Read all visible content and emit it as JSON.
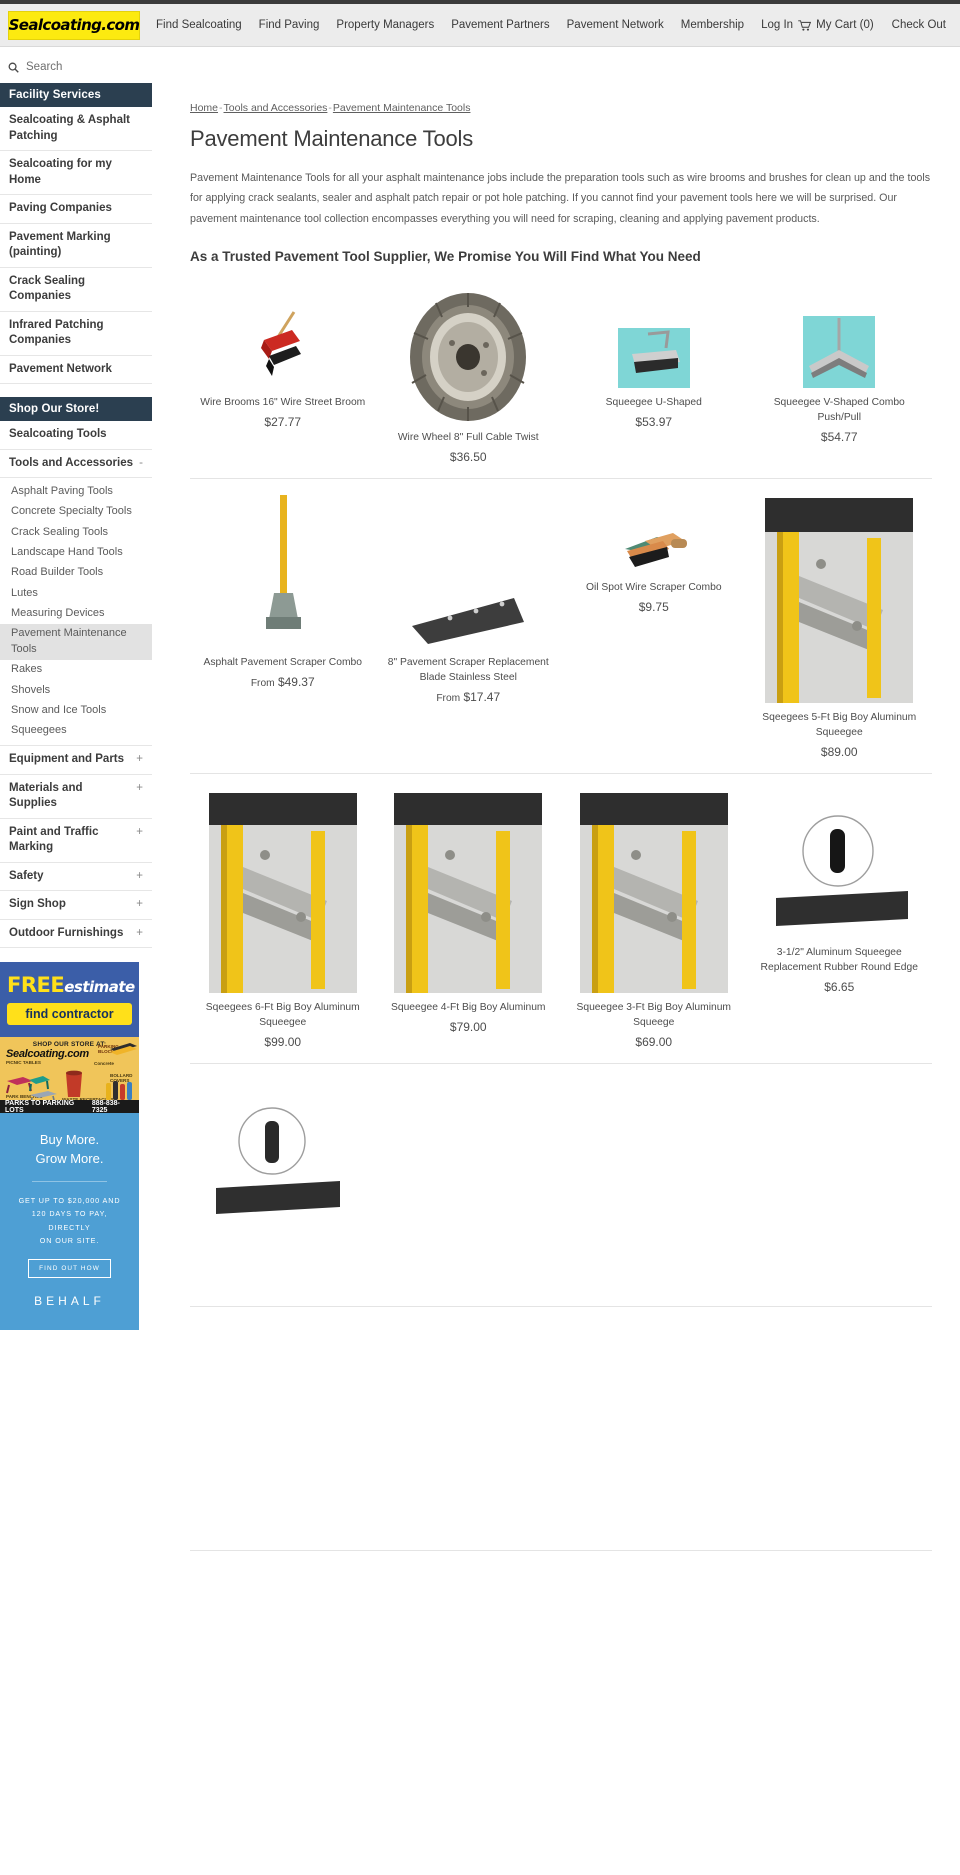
{
  "header": {
    "logo_text": "Sealcoating.com",
    "nav": [
      {
        "label": "Find Sealcoating"
      },
      {
        "label": "Find Paving"
      },
      {
        "label": "Property Managers"
      },
      {
        "label": "Pavement Partners"
      },
      {
        "label": "Pavement Network"
      },
      {
        "label": "Membership"
      },
      {
        "label": "Log In"
      }
    ],
    "cart_label": "My Cart (0)",
    "checkout_label": "Check Out",
    "cart_icon": "shopping-cart-icon"
  },
  "sidebar": {
    "search": {
      "label": "Search",
      "icon": "search-icon"
    },
    "facility": {
      "heading": "Facility Services",
      "items": [
        {
          "label": "Sealcoating & Asphalt Patching"
        },
        {
          "label": "Sealcoating for my Home"
        },
        {
          "label": "Paving Companies"
        },
        {
          "label": "Pavement Marking (painting)"
        },
        {
          "label": "Crack Sealing Companies"
        },
        {
          "label": "Infrared Patching Companies"
        },
        {
          "label": "Pavement Network"
        }
      ]
    },
    "store": {
      "heading": "Shop Our Store!",
      "items": [
        {
          "label": "Sealcoating Tools",
          "toggle": ""
        },
        {
          "label": "Tools and Accessories",
          "toggle": "-"
        },
        {
          "label": "Equipment and Parts",
          "toggle": "+"
        },
        {
          "label": "Materials and Supplies",
          "toggle": "+"
        },
        {
          "label": "Paint and Traffic Marking",
          "toggle": "+"
        },
        {
          "label": "Safety",
          "toggle": "+"
        },
        {
          "label": "Sign Shop",
          "toggle": "+"
        },
        {
          "label": "Outdoor Furnishings",
          "toggle": "+"
        }
      ],
      "subitems": [
        {
          "label": "Asphalt Paving Tools",
          "active": false
        },
        {
          "label": "Concrete Specialty Tools",
          "active": false
        },
        {
          "label": "Crack Sealing Tools",
          "active": false
        },
        {
          "label": "Landscape Hand Tools",
          "active": false
        },
        {
          "label": "Road Builder Tools",
          "active": false
        },
        {
          "label": "Lutes",
          "active": false
        },
        {
          "label": "Measuring Devices",
          "active": false
        },
        {
          "label": "Pavement Maintenance Tools",
          "active": true
        },
        {
          "label": "Rakes",
          "active": false
        },
        {
          "label": "Shovels",
          "active": false
        },
        {
          "label": "Snow and Ice Tools",
          "active": false
        },
        {
          "label": "Squeegees",
          "active": false
        }
      ]
    },
    "ads": {
      "free_estimate": {
        "free": "FREE",
        "estimate": "estimate",
        "button": "find contractor"
      },
      "store_ad": {
        "shop": "SHOP OUR STORE AT:",
        "brand": "Sealcoating.com",
        "labels": [
          "PICNIC TABLES",
          "PARK BENCHES",
          "WASTE RECEPTACLES",
          "PARKING BLOCKS",
          "Concrete",
          "BOLLARD COVERS"
        ],
        "footer_left": "PARKS TO PARKING LOTS",
        "footer_right": "888-838-7325"
      },
      "behalf": {
        "line1": "Buy More.",
        "line2": "Grow More.",
        "body1": "GET UP TO $20,000 AND",
        "body2": "120 DAYS TO PAY, DIRECTLY",
        "body3": "ON OUR SITE.",
        "button": "FIND OUT HOW",
        "logo": "BEHALF"
      }
    }
  },
  "main": {
    "breadcrumb": {
      "home": "Home",
      "sep1": "-",
      "category": "Tools and Accessories",
      "sep2": "-",
      "current": "Pavement Maintenance Tools"
    },
    "title": "Pavement Maintenance Tools",
    "intro": "Pavement Maintenance Tools for all your asphalt maintenance jobs include the preparation tools such as wire brooms and brushes for clean up and the tools for applying crack sealants, sealer and asphalt patch repair or pot hole patching.  If you cannot find your pavement tools here we will be surprised.  Our pavement maintenance tool collection encompasses everything you will need for scraping, cleaning and applying pavement products.",
    "subtitle": "As a Trusted Pavement Tool Supplier, We Promise You Will Find What You Need",
    "rows": [
      {
        "products": [
          {
            "name": "Wire Brooms 16\" Wire Street Broom",
            "price": "$27.77",
            "prefix": "",
            "image": "wire-street-broom-image"
          },
          {
            "name": "Wire Wheel 8\" Full Cable Twist",
            "price": "$36.50",
            "prefix": "",
            "image": "wire-wheel-image"
          },
          {
            "name": "Squeegee U-Shaped",
            "price": "$53.97",
            "prefix": "",
            "image": "squeegee-u-shaped-image"
          },
          {
            "name": "Squeegee V-Shaped Combo Push/Pull",
            "price": "$54.77",
            "prefix": "",
            "image": "squeegee-v-shaped-image"
          }
        ]
      },
      {
        "products": [
          {
            "name": "Asphalt Pavement Scraper Combo",
            "price": "$49.37",
            "prefix": "From",
            "image": "pavement-scraper-combo-image"
          },
          {
            "name": "8\" Pavement Scraper Replacement Blade Stainless Steel",
            "price": "$17.47",
            "prefix": "From",
            "image": "scraper-replacement-blade-image"
          },
          {
            "name": "Oil Spot Wire Scraper Combo",
            "price": "$9.75",
            "prefix": "",
            "image": "oil-spot-wire-scraper-image"
          },
          {
            "name": "Sqeegees 5-Ft Big Boy Aluminum Squeegee",
            "price": "$89.00",
            "prefix": "",
            "image": "big-boy-5ft-squeegee-image"
          }
        ]
      },
      {
        "products": [
          {
            "name": "Sqeegees 6-Ft Big Boy Aluminum Squeegee",
            "price": "$99.00",
            "prefix": "",
            "image": "big-boy-6ft-squeegee-image"
          },
          {
            "name": "Squeegee 4-Ft Big Boy Aluminum",
            "price": "$79.00",
            "prefix": "",
            "image": "big-boy-4ft-squeegee-image"
          },
          {
            "name": "Squeegee 3-Ft Big Boy Aluminum Squeege",
            "price": "$69.00",
            "prefix": "",
            "image": "big-boy-3ft-squeegee-image"
          },
          {
            "name": "3-1/2\" Aluminum Squeegee Replacement Rubber Round Edge",
            "price": "$6.65",
            "prefix": "",
            "image": "squeegee-replacement-rubber-image"
          }
        ]
      }
    ]
  },
  "colors": {
    "brand_yellow": "#fcea10",
    "menu_header": "#2b3f50",
    "ad_blue": "#3b5ea8",
    "behalf_blue": "#4e9fd4",
    "active_sub": "#e2e2e2"
  }
}
